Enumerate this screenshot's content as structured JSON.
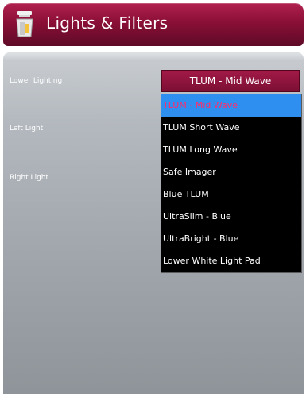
{
  "window": {
    "title": "Lights & Filters",
    "icon": "lamp-filter-icon",
    "colors": {
      "title_bar": "#8a0f37",
      "select_box": "#8e1340",
      "selected_item_bg": "#2f8ff0",
      "selected_item_text": "#ff2b6b",
      "dropdown_bg": "#000000"
    }
  },
  "settings": {
    "lower_lighting": {
      "label": "Lower Lighting",
      "value": "TLUM - Mid Wave",
      "options": [
        "TLUM - Mid Wave",
        "TLUM Short Wave",
        "TLUM Long Wave",
        "Safe Imager",
        "Blue TLUM",
        "UltraSlim - Blue",
        "UltraBright - Blue",
        "Lower White Light Pad"
      ]
    },
    "left_light": {
      "label": "Left Light"
    },
    "right_light": {
      "label": "Right Light"
    }
  }
}
